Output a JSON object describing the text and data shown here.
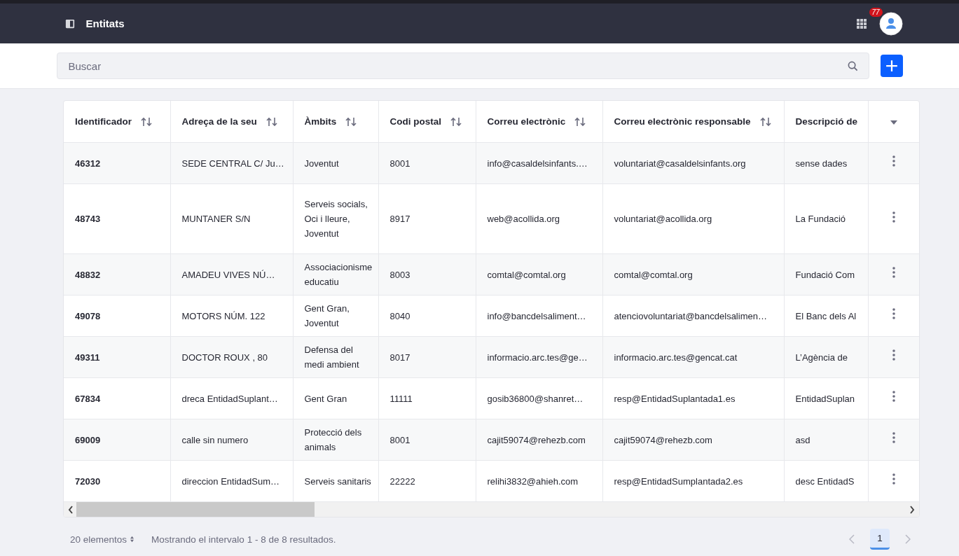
{
  "header": {
    "title": "Entitats",
    "notification_count": "77"
  },
  "search": {
    "placeholder": "Buscar"
  },
  "table": {
    "columns": [
      {
        "label": "Identificador",
        "sortable": true
      },
      {
        "label": "Adreça de la seu",
        "sortable": true
      },
      {
        "label": "Àmbits",
        "sortable": true
      },
      {
        "label": "Codi postal",
        "sortable": true
      },
      {
        "label": "Correu electrònic",
        "sortable": true
      },
      {
        "label": "Correu electrònic responsable",
        "sortable": true
      },
      {
        "label": "Descripció de",
        "sortable": false
      }
    ],
    "rows": [
      [
        "46312",
        "SEDE CENTRAL C/ Ju…",
        "Joventut",
        "8001",
        "info@casaldelsinfants.…",
        "voluntariat@casaldelsinfants.org",
        "sense dades"
      ],
      [
        "48743",
        "MUNTANER S/N",
        "Serveis socials, Oci i lleure, Joventut",
        "8917",
        "web@acollida.org",
        "voluntariat@acollida.org",
        "La Fundació"
      ],
      [
        "48832",
        "AMADEU VIVES NÚ…",
        "Associacionisme educatiu",
        "8003",
        "comtal@comtal.org",
        "comtal@comtal.org",
        "Fundació Com"
      ],
      [
        "49078",
        "MOTORS NÚM. 122",
        "Gent Gran, Joventut",
        "8040",
        "info@bancdelsaliment…",
        "atenciovoluntariat@bancdelsalimen…",
        "El Banc dels Al"
      ],
      [
        "49311",
        "DOCTOR ROUX , 80",
        "Defensa del medi ambient",
        "8017",
        "informacio.arc.tes@ge…",
        "informacio.arc.tes@gencat.cat",
        "L’Agència de"
      ],
      [
        "67834",
        "dreca EntidadSuplant…",
        "Gent Gran",
        "11111",
        "gosib36800@shanret…",
        "resp@EntidadSuplantada1.es",
        "EntidadSuplan"
      ],
      [
        "69009",
        "calle sin numero",
        "Protecció dels animals",
        "8001",
        "cajit59074@rehezb.com",
        "cajit59074@rehezb.com",
        "asd"
      ],
      [
        "72030",
        "direccion EntidadSum…",
        "Serveis sanitaris",
        "22222",
        "relihi3832@ahieh.com",
        "resp@EntidadSumplantada2.es",
        "desc EntidadS"
      ]
    ]
  },
  "footer": {
    "page_size": "20 elementos",
    "summary": "Mostrando el intervalo 1 - 8 de 8 resultados.",
    "pages": [
      {
        "label": "1",
        "selected": true
      }
    ]
  }
}
